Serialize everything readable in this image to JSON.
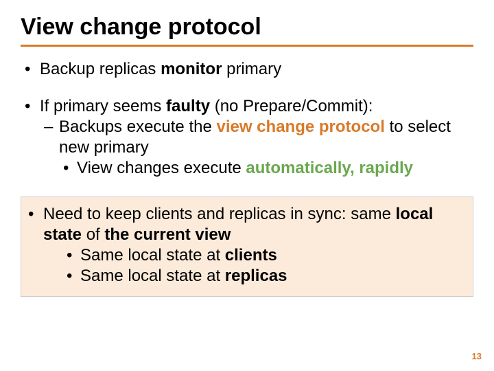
{
  "title": "View change protocol",
  "b1": {
    "pre": "Backup replicas ",
    "bold": "monitor",
    "post": " primary"
  },
  "b2": {
    "pre": "If primary seems ",
    "bold": "faulty",
    "post": " (no Prepare/Commit):"
  },
  "b2a": {
    "pre": "Backups execute the ",
    "bold": "view change protocol",
    "post": " to select new primary"
  },
  "b2b": {
    "pre": "View changes execute ",
    "bold": "automatically, rapidly"
  },
  "b3": {
    "pre": "Need to keep clients and replicas in sync: same ",
    "bold1": "local state",
    "mid": " of ",
    "bold2": "the current view"
  },
  "b3a": {
    "pre": "Same local state at ",
    "bold": "clients"
  },
  "b3b": {
    "pre": "Same local state at ",
    "bold": "replicas"
  },
  "page_number": "13"
}
